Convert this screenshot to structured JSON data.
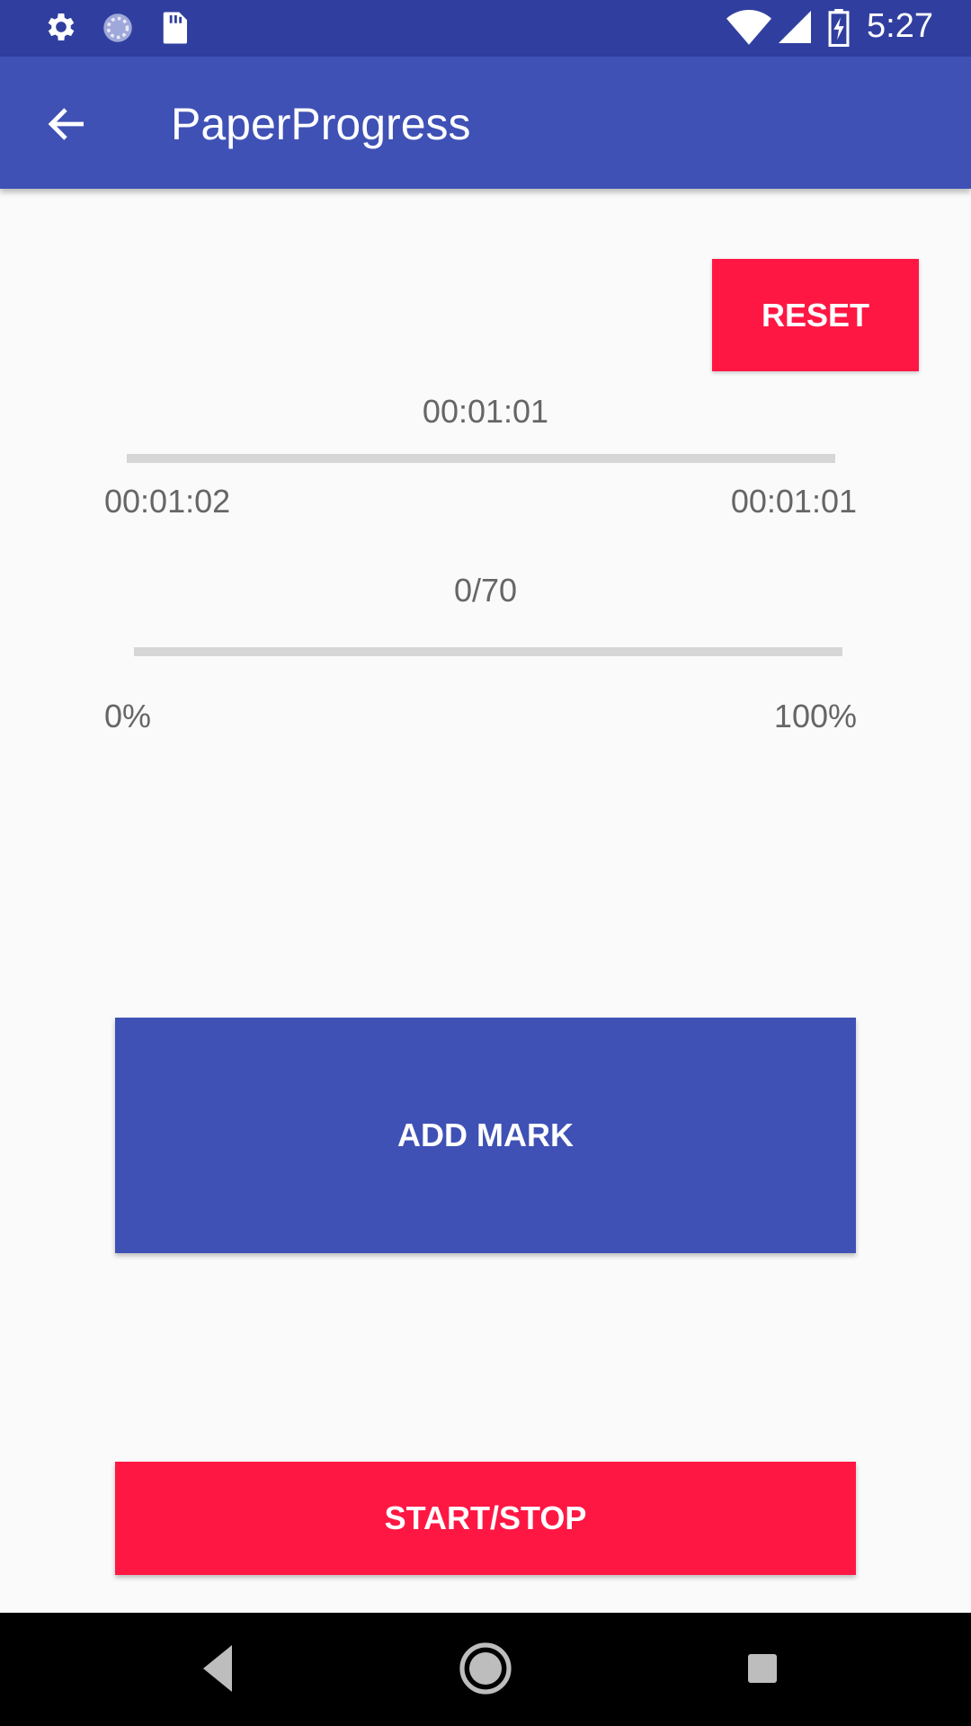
{
  "status_bar": {
    "time": "5:27",
    "icons": [
      "settings-icon",
      "sync-icon",
      "sd-card-icon",
      "wifi-icon",
      "signal-icon",
      "battery-charging-icon"
    ]
  },
  "app_bar": {
    "title": "PaperProgress",
    "back_icon": "arrow-back-icon"
  },
  "reset_label": "RESET",
  "timer": {
    "current": "00:01:01",
    "start_label": "00:01:02",
    "end_label": "00:01:01",
    "progress": 0
  },
  "marks": {
    "count": "0/70",
    "start_label": "0%",
    "end_label": "100%",
    "progress": 0
  },
  "add_mark_label": "ADD MARK",
  "start_stop_label": "START/STOP",
  "nav": {
    "icons": [
      "back-triangle-icon",
      "home-circle-icon",
      "recents-square-icon"
    ]
  },
  "colors": {
    "primary": "#3F51B5",
    "primary_dark": "#303F9F",
    "accent": "#FF1744"
  }
}
